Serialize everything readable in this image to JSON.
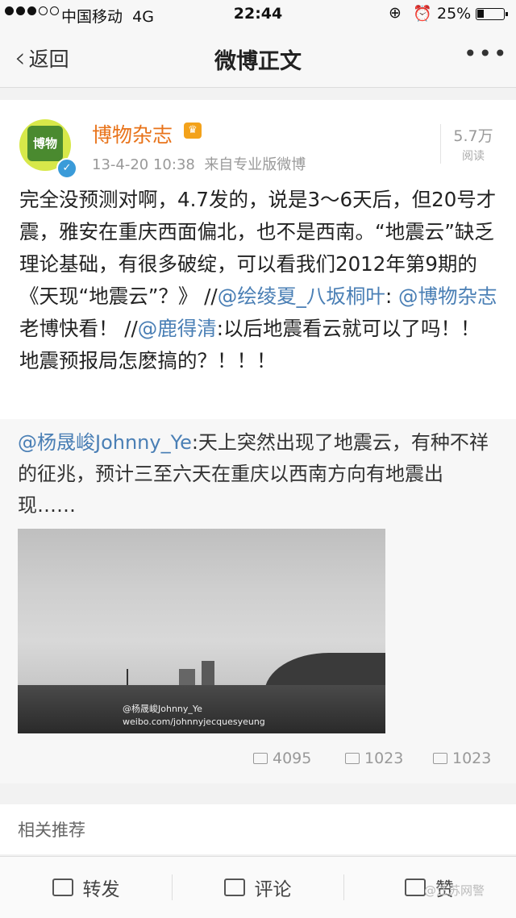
{
  "status_bar": {
    "carrier": "中国移动",
    "network": "4G",
    "time": "22:44",
    "battery": "25%",
    "battery_level": 0.25
  },
  "nav": {
    "back_label": "返回",
    "title": "微博正文",
    "more": "•••"
  },
  "post": {
    "author": "博物杂志",
    "avatar_text": "博物",
    "verified_mark": "✓",
    "crown_mark": "♛",
    "date": "13-4-20 10:38",
    "source": "来自专业版微博",
    "reads_count": "5.7万",
    "reads_label": "阅读",
    "body_1": "完全没预测对啊，4.7发的，说是3～6天后，但20号才震，雅安在重庆西面偏北，也不是西南。“地震云”缺乏理论基础，有很多破绽，可以看我们2012年第9期的《天现“地震云”？》 //",
    "mention_1": "@绘绫夏_八坂桐叶",
    "body_2": ": ",
    "mention_2": "@博物杂志",
    "body_3": " 老博快看！ //",
    "mention_3": "@鹿得清",
    "body_4": ":以后地震看云就可以了吗！！ 地震预报局怎麽搞的？！！！"
  },
  "repost": {
    "mention": "@杨晟峻Johnny_Ye",
    "text": ":天上突然出现了地震云，有种不祥的征兆，预计三至六天在重庆以西南方向有地震出现……",
    "image_watermark_1": "@杨晟峻Johnny_Ye",
    "image_watermark_2": "weibo.com/johnnyjecquesyeung"
  },
  "actions": {
    "reposts": "4095",
    "comments": "1023",
    "likes": "1023"
  },
  "related": {
    "label": "相关推荐"
  },
  "toolbar": {
    "repost_label": "转发",
    "comment_label": "评论",
    "like_label": "赞"
  },
  "watermark": "@江苏网警"
}
